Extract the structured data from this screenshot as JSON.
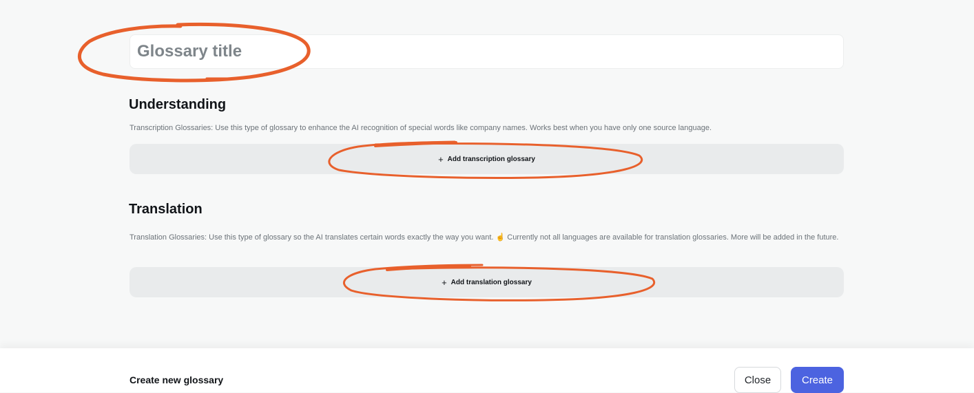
{
  "glossary_title": {
    "placeholder": "Glossary title",
    "value": ""
  },
  "understanding": {
    "heading": "Understanding",
    "description": "Transcription Glossaries: Use this type of glossary to enhance the AI recognition of special words like company names. Works best when you have only one source language.",
    "add_label": "Add transcription glossary",
    "add_icon": "plus-icon"
  },
  "translation": {
    "heading": "Translation",
    "description": "Translation Glossaries: Use this type of glossary so the AI translates certain words exactly the way you want. ☝️ Currently not all languages are available for translation glossaries. More will be added in the future.",
    "add_label": "Add translation glossary",
    "add_icon": "plus-icon"
  },
  "footer": {
    "title": "Create new glossary",
    "close_label": "Close",
    "create_label": "Create"
  },
  "colors": {
    "accent": "#4c63e0",
    "annotation": "#e8602c",
    "panel_bg": "#f7f8f8",
    "add_button_bg": "#e9ebec"
  }
}
